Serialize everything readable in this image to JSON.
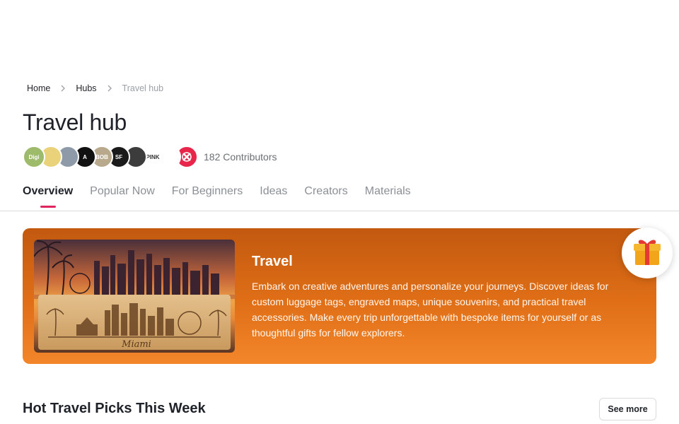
{
  "breadcrumb": {
    "home": "Home",
    "hubs": "Hubs",
    "current": "Travel hub"
  },
  "page": {
    "title": "Travel hub",
    "contributors_label": "182 Contributors"
  },
  "avatars": [
    {
      "text": "Digi",
      "color": "#9dbb6b"
    },
    {
      "text": "",
      "color": "#e9d27a"
    },
    {
      "text": "",
      "color": "#8e9aa8"
    },
    {
      "text": "A",
      "color": "#111111"
    },
    {
      "text": "BOB",
      "color": "#b8a98c"
    },
    {
      "text": "SF",
      "color": "#1a1a1a"
    },
    {
      "text": "",
      "color": "#3c3c3c"
    },
    {
      "text": "PINK",
      "color": "#ffffff"
    },
    {
      "text": "",
      "color": "#ffffff"
    },
    {
      "text": "",
      "color": "#e8254a"
    }
  ],
  "tabs": [
    {
      "label": "Overview",
      "active": true
    },
    {
      "label": "Popular Now",
      "active": false
    },
    {
      "label": "For Beginners",
      "active": false
    },
    {
      "label": "Ideas",
      "active": false
    },
    {
      "label": "Creators",
      "active": false
    },
    {
      "label": "Materials",
      "active": false
    }
  ],
  "banner": {
    "title": "Travel",
    "description": "Embark on creative adventures and personalize your journeys. Discover ideas for custom luggage tags, engraved maps, unique souvenirs, and practical travel accessories. Make every trip unforgettable with bespoke items for yourself or as thoughtful gifts for fellow explorers.",
    "image_caption": "Miami"
  },
  "section": {
    "title": "Hot Travel Picks This Week",
    "see_more_label": "See more"
  },
  "colors": {
    "accent": "#e0245e",
    "banner_orange": "#e06f17"
  },
  "icons": {
    "breadcrumb_separator": "chevron-right-icon",
    "gift": "gift-icon"
  }
}
